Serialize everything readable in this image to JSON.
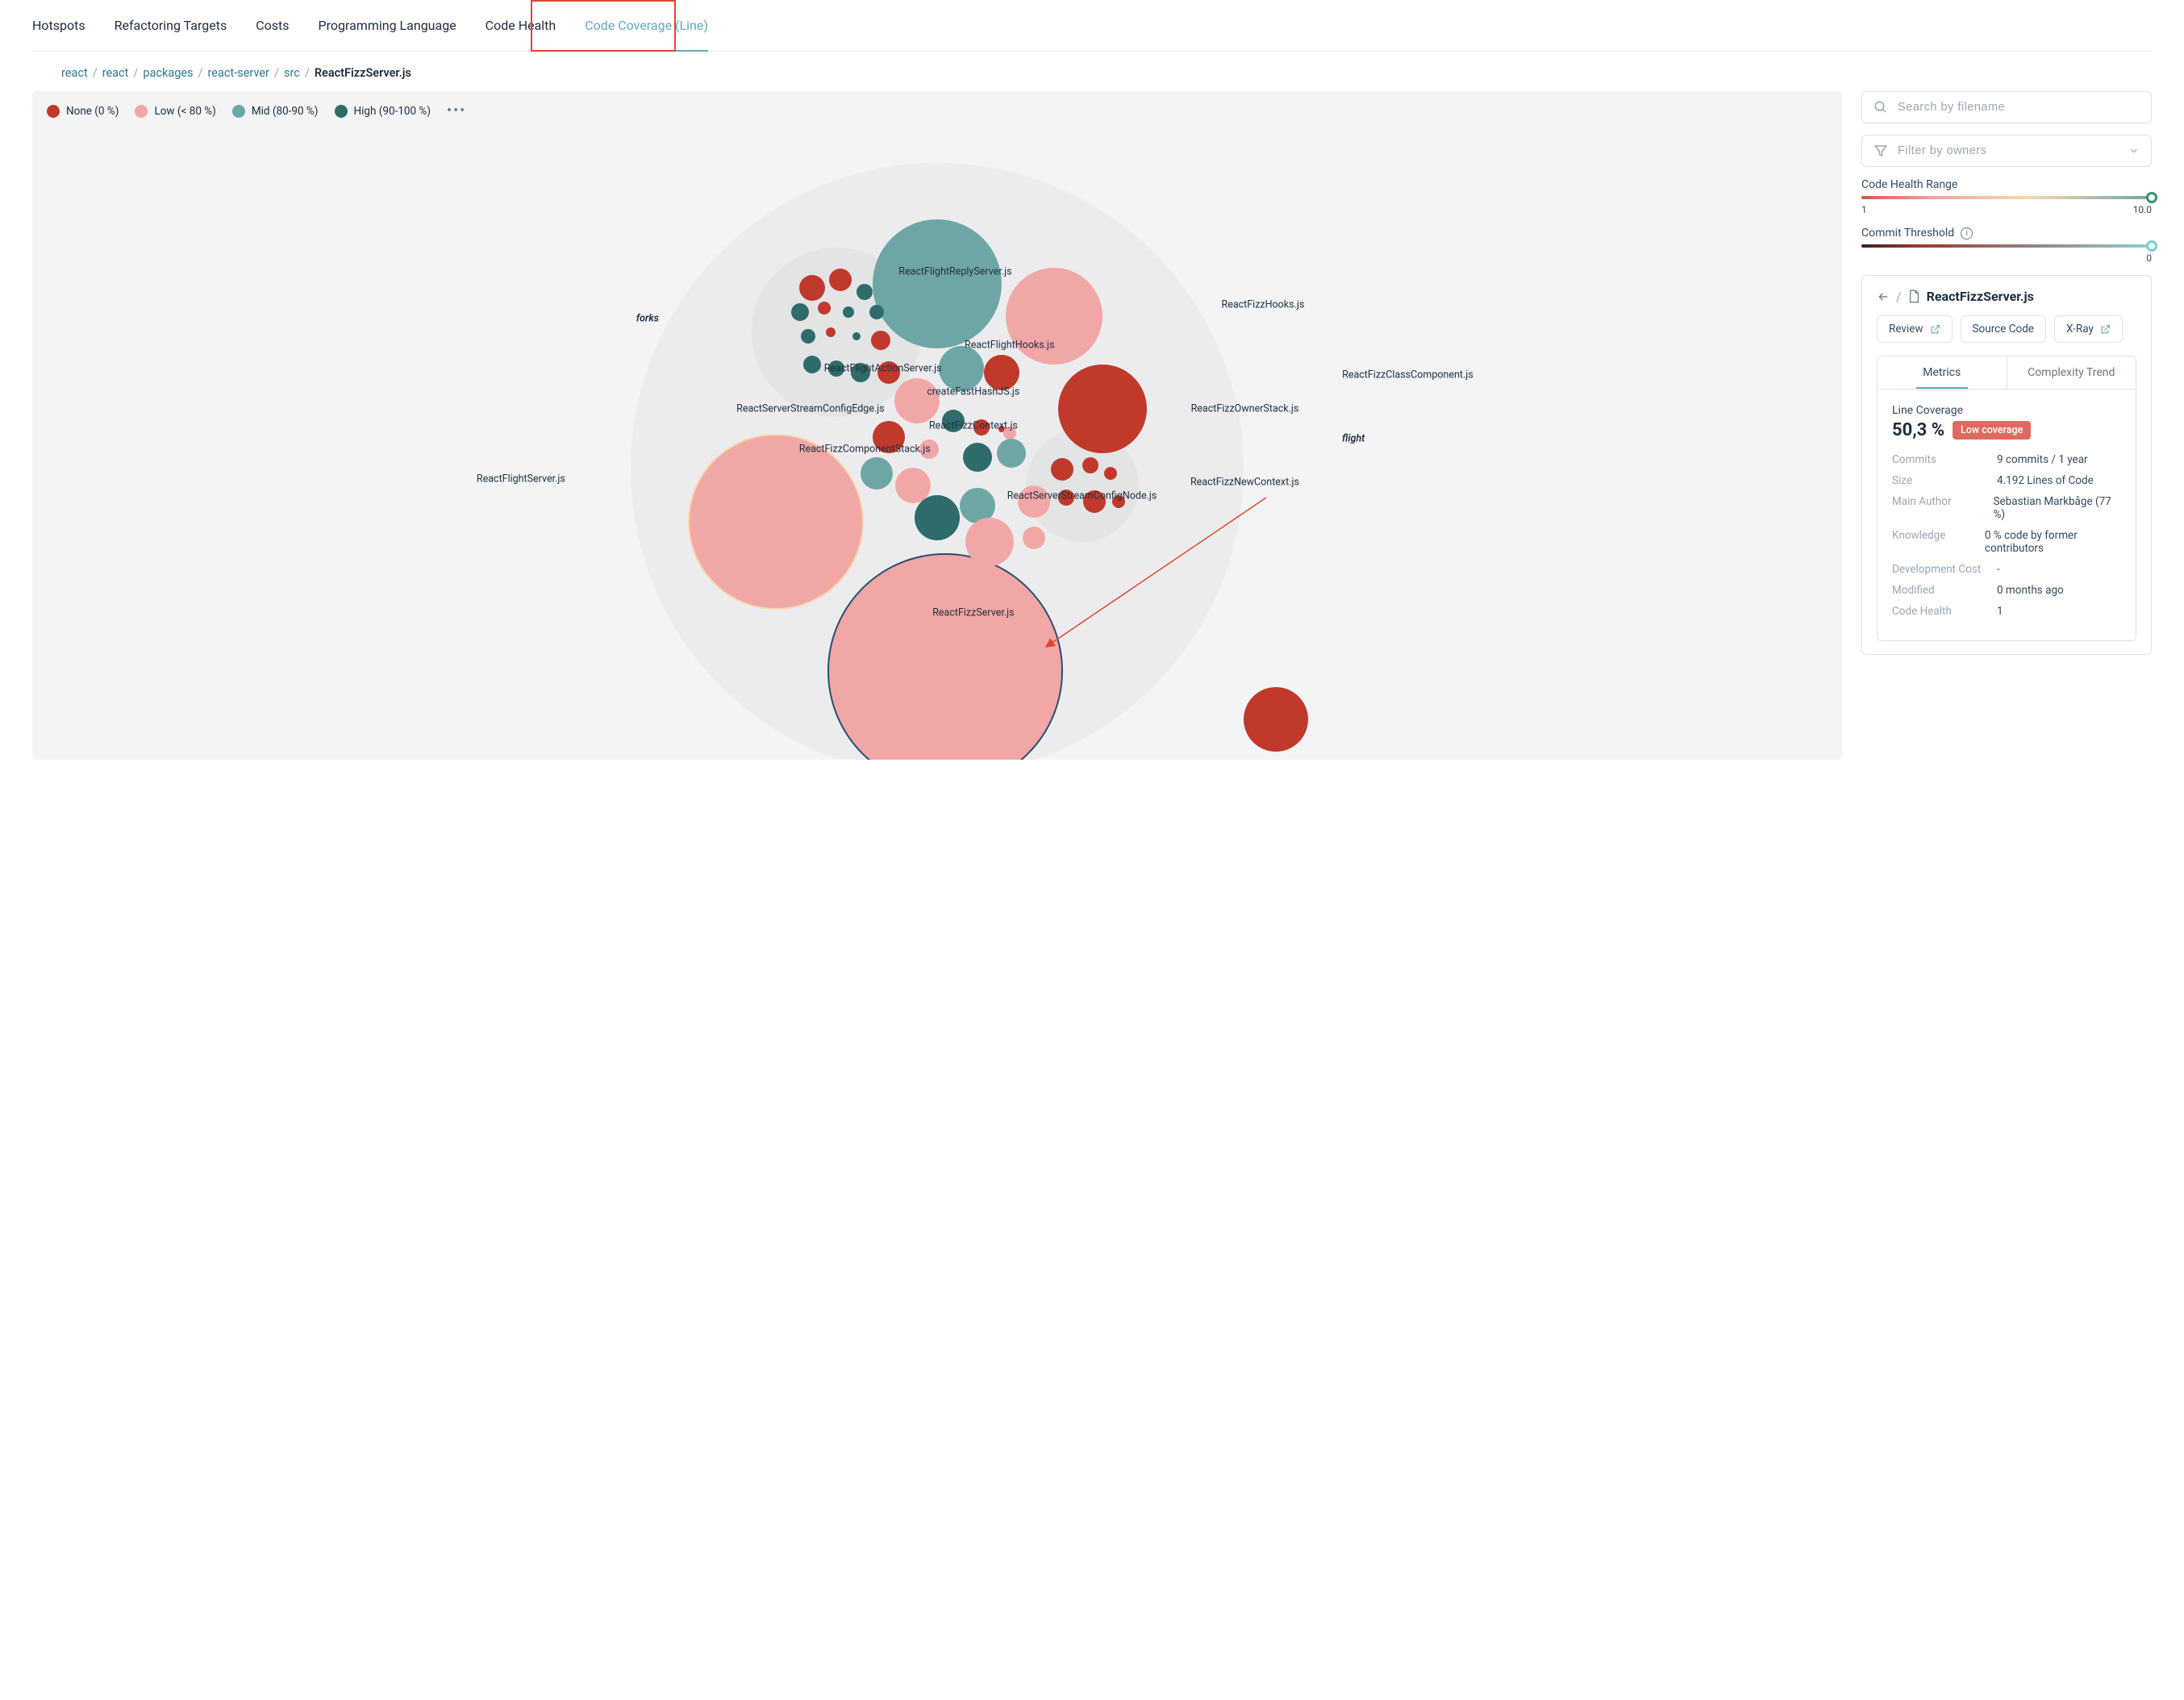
{
  "tabs": {
    "items": [
      "Hotspots",
      "Refactoring Targets",
      "Costs",
      "Programming Language",
      "Code Health",
      "Code Coverage (Line)"
    ],
    "active_index": 5
  },
  "breadcrumb": {
    "parts": [
      "react",
      "react",
      "packages",
      "react-server",
      "src"
    ],
    "current": "ReactFizzServer.js"
  },
  "legend": {
    "none": "None (0 %)",
    "low": "Low (< 80 %)",
    "mid": "Mid (80-90 %)",
    "high": "High (90-100 %)"
  },
  "search": {
    "placeholder": "Search by filename"
  },
  "filter": {
    "placeholder": "Filter by owners"
  },
  "health_slider": {
    "label": "Code Health Range",
    "min": "1",
    "max": "10.0"
  },
  "commit_slider": {
    "label": "Commit Threshold",
    "max": "0"
  },
  "card": {
    "filename": "ReactFizzServer.js",
    "buttons": {
      "review": "Review",
      "source": "Source Code",
      "xray": "X-Ray"
    },
    "sub_tabs": {
      "metrics": "Metrics",
      "complexity": "Complexity Trend"
    },
    "metric_title": "Line Coverage",
    "metric_value": "50,3 %",
    "badge": "Low coverage",
    "rows": {
      "commits": {
        "k": "Commits",
        "v": "9 commits / 1 year"
      },
      "size": {
        "k": "Size",
        "v": "4.192 Lines of Code"
      },
      "author": {
        "k": "Main Author",
        "v": "Sebastian Markbåge (77 %)"
      },
      "knowledge": {
        "k": "Knowledge",
        "v": "0 % code by former contributors"
      },
      "cost": {
        "k": "Development Cost",
        "v": "-"
      },
      "modified": {
        "k": "Modified",
        "v": "0 months ago"
      },
      "health": {
        "k": "Code Health",
        "v": "1"
      }
    }
  },
  "chart_data": {
    "type": "packed-bubble",
    "legend_categories": [
      "None (0 %)",
      "Low (< 80 %)",
      "Mid (80-90 %)",
      "High (90-100 %)"
    ],
    "color_map": {
      "none": "#c0392b",
      "low": "#f2a7a7",
      "mid": "#6ea6a6",
      "high": "#2f6b6b"
    },
    "groups": [
      "forks",
      "flight"
    ],
    "bubbles": [
      {
        "label": "ReactFizzServer.js",
        "category": "low",
        "radius": 145,
        "selected": true
      },
      {
        "label": "ReactFlightServer.js",
        "category": "low",
        "radius": 108
      },
      {
        "label": "ReactFlightReplyServer.js",
        "category": "mid",
        "radius": 80
      },
      {
        "label": "ReactFizzHooks.js",
        "category": "low",
        "radius": 60
      },
      {
        "label": "ReactFizzClassComponent.js",
        "category": "none",
        "radius": 55
      },
      {
        "label": "ReactFlightHooks.js",
        "category": "mid",
        "radius": 30
      },
      {
        "label": "ReactFlightActionServer.js",
        "category": "low",
        "radius": 28
      },
      {
        "label": "createFastHashJS.js",
        "category": "high",
        "radius": 14
      },
      {
        "label": "ReactServerStreamConfigEdge.js",
        "category": "high",
        "radius": 12
      },
      {
        "label": "ReactFizzOwnerStack.js",
        "category": "low",
        "radius": 20
      },
      {
        "label": "ReactFizzContext.js",
        "category": "high",
        "radius": 18
      },
      {
        "label": "ReactFizzComponentStack.js",
        "category": "low",
        "radius": 22
      },
      {
        "label": "ReactFizzNewContext.js",
        "category": "high",
        "radius": 28
      },
      {
        "label": "ReactServerStreamConfigNode.js",
        "category": "low",
        "radius": 30
      }
    ]
  }
}
